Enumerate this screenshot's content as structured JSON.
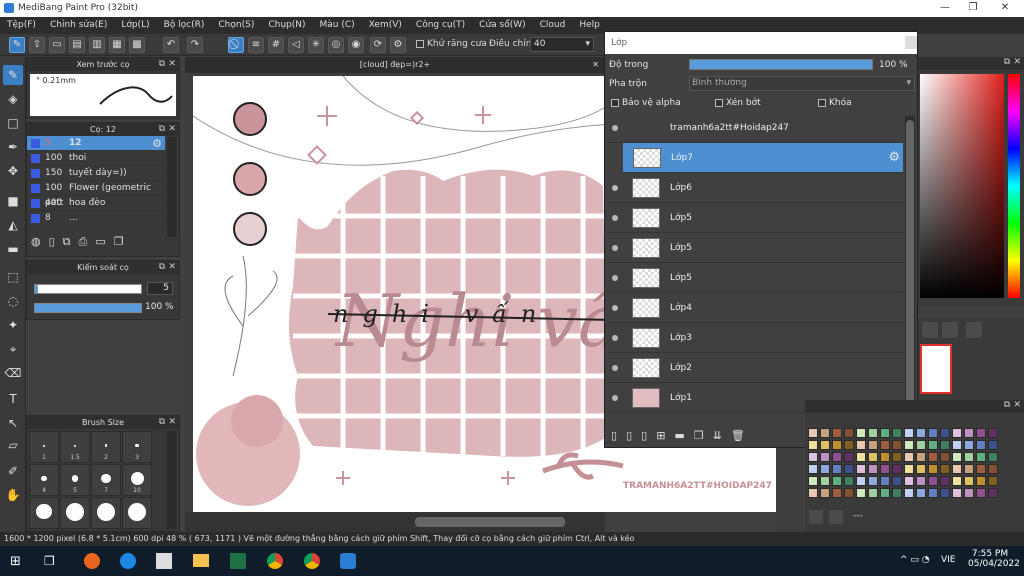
{
  "window": {
    "title": "MediBang Paint Pro (32bit)"
  },
  "menu": [
    "Tệp(F)",
    "Chỉnh sửa(E)",
    "Lớp(L)",
    "Bộ lọc(R)",
    "Chọn(S)",
    "Chụp(N)",
    "Màu (C)",
    "Xem(V)",
    "Công cụ(T)",
    "Cửa sổ(W)",
    "Cloud",
    "Help"
  ],
  "toolbar": {
    "antialias_label": "Khử răng cưa",
    "stabilizer_label": "Điều chỉnh",
    "stabilizer_value": "40"
  },
  "preview_panel": {
    "title": "Xem trước cọ",
    "size": "° 0.21mm"
  },
  "brush_panel": {
    "title": "Cọ: 12",
    "items": [
      {
        "size": "5",
        "name": "12"
      },
      {
        "size": "100",
        "name": "thoi"
      },
      {
        "size": "150",
        "name": "tuyết dày=))"
      },
      {
        "size": "100",
        "name": "Flower (geometric patt"
      },
      {
        "size": "400",
        "name": "hoa đèo"
      },
      {
        "size": "8",
        "name": "..."
      }
    ]
  },
  "control_panel": {
    "title": "Kiểm soát cọ",
    "size_value": "5",
    "opacity_value": "100 %",
    "size_level": 0.03,
    "opacity_level": 1.0
  },
  "brushsize_panel": {
    "title": "Brush Size",
    "labels": [
      "1",
      "1.5",
      "2",
      "3",
      "4",
      "5",
      "7",
      "10"
    ]
  },
  "document": {
    "tab_title": "[cloud] đẹp=)r2+",
    "watermark": "TRAMANH6A2TT#HOIDAP247",
    "text_a": "nghi vấn",
    "text_b": "Nghi vấn"
  },
  "layer_panel": {
    "title": "Lớp",
    "opacity_label": "Độ trong",
    "opacity_value": "100 %",
    "blend_label": "Pha trộn",
    "blend_value": "Bình thường",
    "protect_alpha": "Bảo vệ alpha",
    "clipping": "Xén bớt",
    "lock": "Khóa",
    "layers": [
      "tramanh6a2tt#Hoidap247",
      "Lớp7",
      "Lớp6",
      "Lớp5",
      "Lớp5",
      "Lớp5",
      "Lớp4",
      "Lớp3",
      "Lớp2",
      "Lớp1"
    ]
  },
  "palette_panel": {
    "footer": "---"
  },
  "status": {
    "text": "1600 * 1200 pixel  (6.8 * 5.1cm)  600 dpi  48 %  ( 673, 1171 )  Vẽ một đường thẳng bằng cách giữ phím Shift, Thay đổi cỡ cọ bằng cách giữ phím Ctrl, Alt và kéo"
  },
  "taskbar": {
    "time": "7:55 PM",
    "date": "05/04/2022",
    "lang": "VIE"
  }
}
